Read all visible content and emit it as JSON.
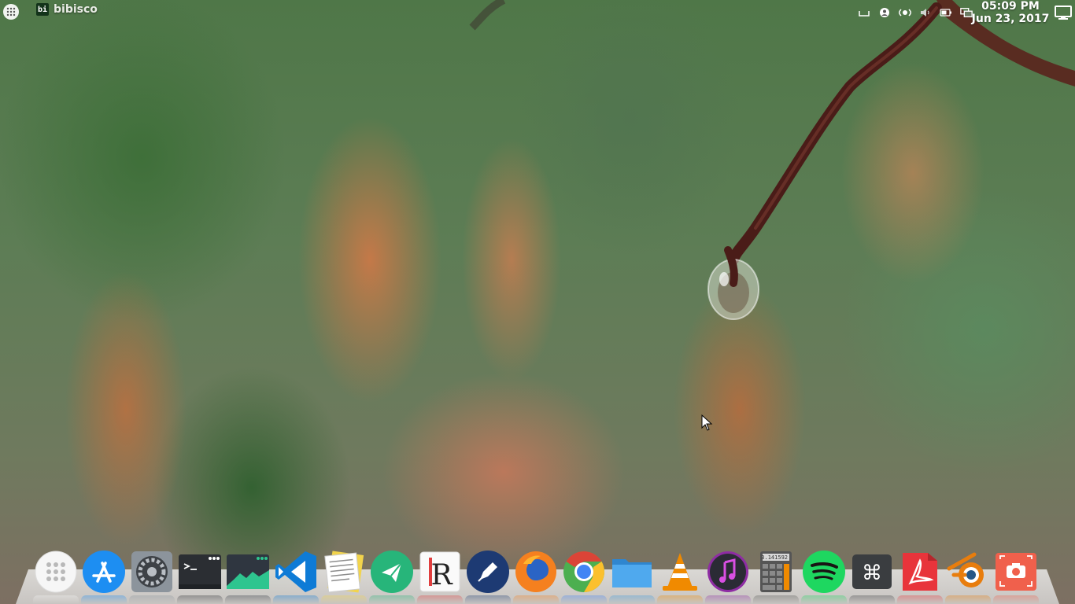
{
  "top_panel": {
    "active_app": {
      "icon_text": "bi",
      "name": "bibisco"
    },
    "tray_icons": [
      "keyboard-layout-icon",
      "user-icon",
      "network-icon",
      "volume-icon",
      "battery-icon",
      "screen-icon"
    ],
    "clock": {
      "time": "05:09 PM",
      "date": "Jun 23, 2017"
    }
  },
  "dock": {
    "items": [
      {
        "name": "app-grid",
        "color": "#f4f4f4"
      },
      {
        "name": "app-store",
        "color": "#1d8ef2"
      },
      {
        "name": "system-preferences",
        "color": "#8c949c"
      },
      {
        "name": "terminal",
        "color": "#2b2e33"
      },
      {
        "name": "system-monitor",
        "color": "#2f3640"
      },
      {
        "name": "visual-studio-code",
        "color": "#0e7bd6"
      },
      {
        "name": "notes",
        "color": "#f2d44c"
      },
      {
        "name": "telegram",
        "color": "#27b57a"
      },
      {
        "name": "rstudio",
        "color": "#e03e3e"
      },
      {
        "name": "writer",
        "color": "#1d3a73"
      },
      {
        "name": "firefox",
        "color": "#f5801f"
      },
      {
        "name": "chrome",
        "color": "#4285f4"
      },
      {
        "name": "files",
        "color": "#3c9be0"
      },
      {
        "name": "vlc",
        "color": "#f08a00"
      },
      {
        "name": "music",
        "color": "#8e2ca3"
      },
      {
        "name": "calculator",
        "color": "#555555"
      },
      {
        "name": "spotify",
        "color": "#1ed760"
      },
      {
        "name": "keyboard-shortcuts",
        "color": "#3a3d40"
      },
      {
        "name": "pdf-reader",
        "color": "#e8343b"
      },
      {
        "name": "blender",
        "color": "#e87d0d"
      },
      {
        "name": "screenshot",
        "color": "#f0604c"
      }
    ],
    "labels": {
      "calculator_display": "3.141592"
    }
  }
}
